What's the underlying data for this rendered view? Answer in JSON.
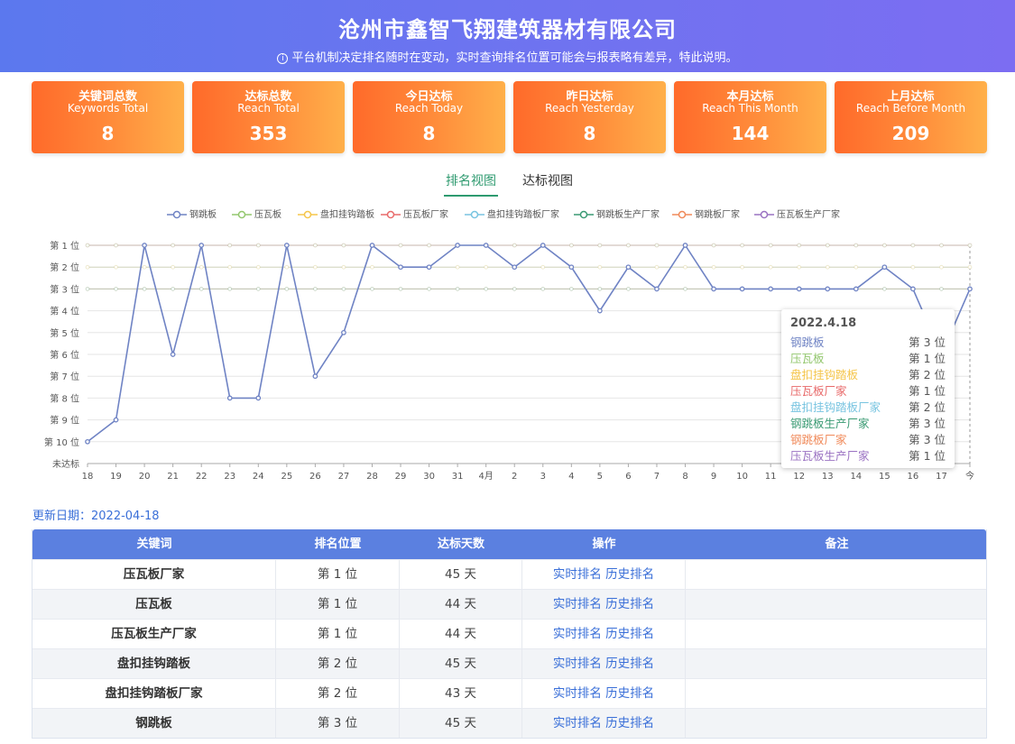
{
  "header": {
    "title": "沧州市鑫智飞翔建筑器材有限公司",
    "notice": "平台机制决定排名随时在变动，实时查询排名位置可能会与报表略有差异，特此说明。"
  },
  "stats": [
    {
      "cn": "关键词总数",
      "en": "Keywords Total",
      "value": "8"
    },
    {
      "cn": "达标总数",
      "en": "Reach Total",
      "value": "353"
    },
    {
      "cn": "今日达标",
      "en": "Reach Today",
      "value": "8"
    },
    {
      "cn": "昨日达标",
      "en": "Reach Yesterday",
      "value": "8"
    },
    {
      "cn": "本月达标",
      "en": "Reach This Month",
      "value": "144"
    },
    {
      "cn": "上月达标",
      "en": "Reach Before Month",
      "value": "209"
    }
  ],
  "tabs": {
    "rank_view": "排名视图",
    "reach_view": "达标视图"
  },
  "colors": {
    "header": "#6b75f0",
    "stat_card": "#ff8d3b",
    "active_tab": "#2e9a6f",
    "table_header": "#5b80e0",
    "link": "#3a6fd8"
  },
  "chart_data": {
    "type": "line",
    "legend_position": "top",
    "y_tick_labels": [
      "第 1 位",
      "第 2 位",
      "第 3 位",
      "第 4 位",
      "第 5 位",
      "第 6 位",
      "第 7 位",
      "第 8 位",
      "第 9 位",
      "第 10 位",
      "未达标"
    ],
    "x": [
      "18",
      "19",
      "20",
      "21",
      "22",
      "23",
      "24",
      "25",
      "26",
      "27",
      "28",
      "29",
      "30",
      "31",
      "4月",
      "2",
      "3",
      "4",
      "5",
      "6",
      "7",
      "8",
      "9",
      "10",
      "11",
      "12",
      "13",
      "14",
      "15",
      "16",
      "17",
      "今"
    ],
    "series": [
      {
        "name": "钢跳板",
        "color": "#6f83c4",
        "values": [
          10,
          9,
          1,
          6,
          1,
          8,
          8,
          1,
          7,
          5,
          1,
          2,
          2,
          1,
          1,
          2,
          1,
          2,
          4,
          2,
          3,
          1,
          3,
          3,
          3,
          3,
          3,
          3,
          2,
          3,
          6,
          3
        ]
      },
      {
        "name": "压瓦板",
        "color": "#93c76e",
        "values": [
          1,
          1,
          1,
          1,
          1,
          1,
          1,
          1,
          1,
          1,
          1,
          1,
          1,
          1,
          1,
          1,
          1,
          1,
          1,
          1,
          1,
          1,
          1,
          1,
          1,
          1,
          1,
          1,
          1,
          1,
          1,
          1
        ]
      },
      {
        "name": "盘扣挂钩踏板",
        "color": "#f5c54a",
        "values": [
          2,
          2,
          2,
          2,
          2,
          2,
          2,
          2,
          2,
          2,
          2,
          2,
          2,
          2,
          2,
          2,
          2,
          2,
          2,
          2,
          2,
          2,
          2,
          2,
          2,
          2,
          2,
          2,
          2,
          2,
          2,
          2
        ]
      },
      {
        "name": "压瓦板厂家",
        "color": "#e86a6a",
        "values": [
          1,
          1,
          1,
          1,
          1,
          1,
          1,
          1,
          1,
          1,
          1,
          1,
          1,
          1,
          1,
          1,
          1,
          1,
          1,
          1,
          1,
          1,
          1,
          1,
          1,
          1,
          1,
          1,
          1,
          1,
          1,
          1
        ]
      },
      {
        "name": "盘扣挂钩踏板厂家",
        "color": "#78c4e0",
        "values": [
          2,
          2,
          2,
          2,
          2,
          2,
          2,
          2,
          2,
          2,
          2,
          2,
          2,
          2,
          2,
          2,
          2,
          2,
          2,
          2,
          2,
          2,
          2,
          2,
          2,
          2,
          2,
          2,
          2,
          2,
          2,
          2
        ]
      },
      {
        "name": "钢跳板生产厂家",
        "color": "#3a9a73",
        "values": [
          3,
          3,
          3,
          3,
          3,
          3,
          3,
          3,
          3,
          3,
          3,
          3,
          3,
          3,
          3,
          3,
          3,
          3,
          3,
          3,
          3,
          3,
          3,
          3,
          3,
          3,
          3,
          3,
          3,
          3,
          3,
          3
        ]
      },
      {
        "name": "钢跳板厂家",
        "color": "#f08a5a",
        "values": [
          3,
          3,
          3,
          3,
          3,
          3,
          3,
          3,
          3,
          3,
          3,
          3,
          3,
          3,
          3,
          3,
          3,
          3,
          3,
          3,
          3,
          3,
          3,
          3,
          3,
          3,
          3,
          3,
          3,
          3,
          3,
          3
        ]
      },
      {
        "name": "压瓦板生产厂家",
        "color": "#9a72c2",
        "values": [
          1,
          1,
          1,
          1,
          1,
          1,
          1,
          1,
          1,
          1,
          1,
          1,
          1,
          1,
          1,
          1,
          1,
          1,
          1,
          1,
          1,
          1,
          1,
          1,
          1,
          1,
          1,
          1,
          1,
          1,
          1,
          1
        ]
      }
    ],
    "tooltip": {
      "date": "2022.4.18",
      "rows": [
        {
          "name": "钢跳板",
          "value": "第 3 位"
        },
        {
          "name": "压瓦板",
          "value": "第 1 位"
        },
        {
          "name": "盘扣挂钩踏板",
          "value": "第 2 位"
        },
        {
          "name": "压瓦板厂家",
          "value": "第 1 位"
        },
        {
          "name": "盘扣挂钩踏板厂家",
          "value": "第 2 位"
        },
        {
          "name": "钢跳板生产厂家",
          "value": "第 3 位"
        },
        {
          "name": "钢跳板厂家",
          "value": "第 3 位"
        },
        {
          "name": "压瓦板生产厂家",
          "value": "第 1 位"
        }
      ]
    }
  },
  "update": {
    "label": "更新日期：",
    "date": "2022-04-18"
  },
  "table": {
    "headers": [
      "关键词",
      "排名位置",
      "达标天数",
      "操作",
      "备注"
    ],
    "rows": [
      {
        "keyword": "压瓦板厂家",
        "rank": "第 1 位",
        "days": "45 天",
        "op1": "实时排名",
        "op2": "历史排名",
        "note": ""
      },
      {
        "keyword": "压瓦板",
        "rank": "第 1 位",
        "days": "44 天",
        "op1": "实时排名",
        "op2": "历史排名",
        "note": ""
      },
      {
        "keyword": "压瓦板生产厂家",
        "rank": "第 1 位",
        "days": "44 天",
        "op1": "实时排名",
        "op2": "历史排名",
        "note": ""
      },
      {
        "keyword": "盘扣挂钩踏板",
        "rank": "第 2 位",
        "days": "45 天",
        "op1": "实时排名",
        "op2": "历史排名",
        "note": ""
      },
      {
        "keyword": "盘扣挂钩踏板厂家",
        "rank": "第 2 位",
        "days": "43 天",
        "op1": "实时排名",
        "op2": "历史排名",
        "note": ""
      },
      {
        "keyword": "钢跳板",
        "rank": "第 3 位",
        "days": "45 天",
        "op1": "实时排名",
        "op2": "历史排名",
        "note": ""
      }
    ]
  }
}
